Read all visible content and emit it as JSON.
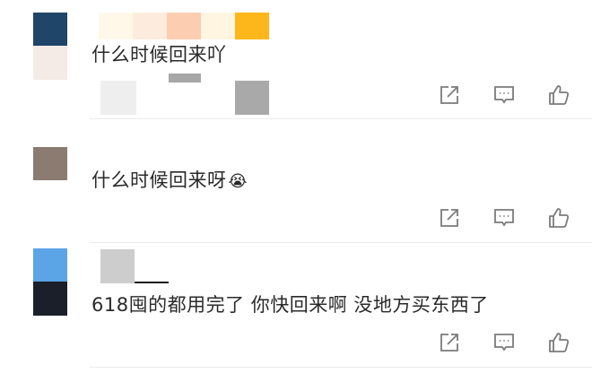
{
  "comments": [
    {
      "text": "什么时候回来吖",
      "emoji": "",
      "emoji_icon": "",
      "avatar_colors": [
        "#1f4568",
        "#f5ebe6"
      ],
      "name_bar_colors": [
        "#fff8e9",
        "#fdecde",
        "#fdcdb1",
        "#fff5e1",
        "#fdb71b"
      ],
      "image_tones": [
        "#eeeeee",
        "#a7a7a7",
        "#a9a9a9"
      ]
    },
    {
      "text": "什么时候回来呀",
      "emoji": "😭",
      "emoji_icon": "crying-face-icon",
      "avatar_colors": [
        "#8b7b70"
      ]
    },
    {
      "text": "618囤的都用完了 你快回来啊 没地方买东西了",
      "emoji": "",
      "emoji_icon": "",
      "avatar_colors": [
        "#5ba4e5",
        "#1a1f2a"
      ],
      "name_bar_colors": [
        "#cdcdcd",
        "#1c1c1c"
      ]
    }
  ],
  "actions": [
    {
      "icon": "share-icon"
    },
    {
      "icon": "reply-comment-icon"
    },
    {
      "icon": "thumbs-up-icon"
    }
  ],
  "colors": {
    "icon": "#7b7b7b",
    "divider": "#ececec",
    "text": "#2a2a2a"
  }
}
